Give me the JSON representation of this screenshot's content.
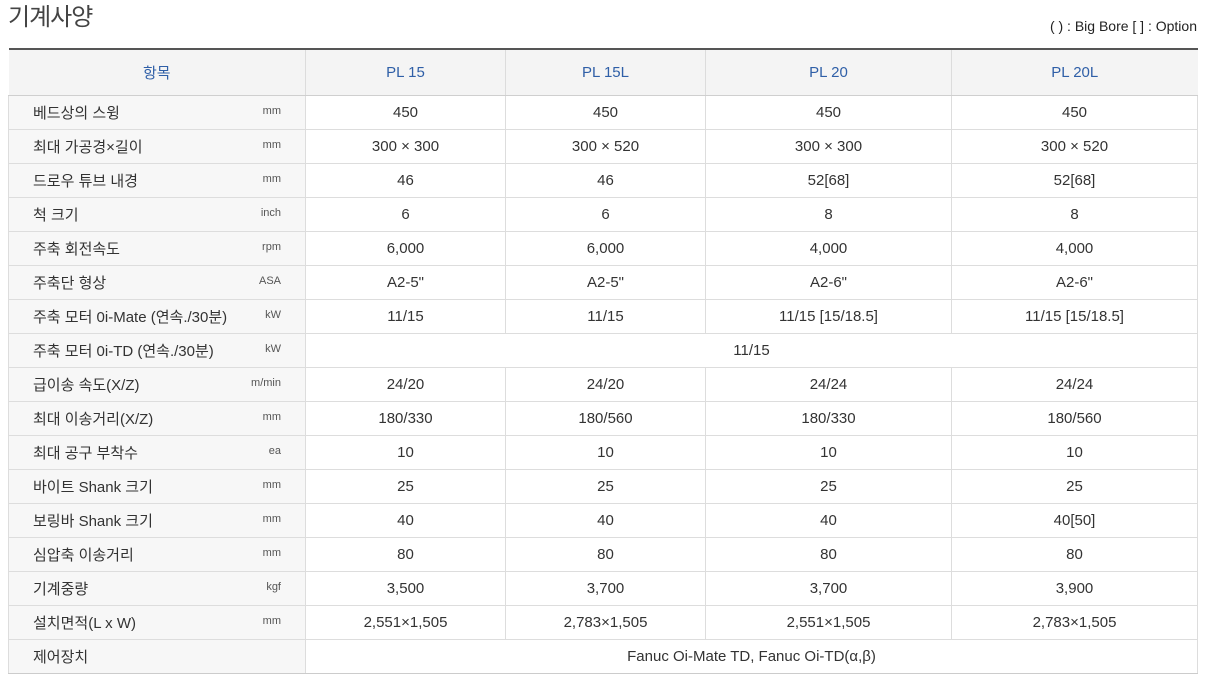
{
  "page_title": "기계사양",
  "legend": "( ) : Big Bore  [ ] : Option",
  "header": {
    "item": "항목",
    "models": [
      "PL 15",
      "PL 15L",
      "PL 20",
      "PL 20L"
    ]
  },
  "rows": [
    {
      "label": "베드상의 스윙",
      "unit": "mm",
      "values": [
        "450",
        "450",
        "450",
        "450"
      ]
    },
    {
      "label": "최대 가공경×길이",
      "unit": "mm",
      "values": [
        "300 × 300",
        "300 × 520",
        "300 × 300",
        "300 × 520"
      ]
    },
    {
      "label": "드로우 튜브 내경",
      "unit": "mm",
      "values": [
        "46",
        "46",
        "52[68]",
        "52[68]"
      ]
    },
    {
      "label": "척 크기",
      "unit": "inch",
      "values": [
        "6",
        "6",
        "8",
        "8"
      ]
    },
    {
      "label": "주축 회전속도",
      "unit": "rpm",
      "values": [
        "6,000",
        "6,000",
        "4,000",
        "4,000"
      ]
    },
    {
      "label": "주축단 형상",
      "unit": "ASA",
      "values": [
        "A2-5\"",
        "A2-5\"",
        "A2-6\"",
        "A2-6\""
      ]
    },
    {
      "label": "주축 모터 0i-Mate (연속./30분)",
      "unit": "kW",
      "values": [
        "11/15",
        "11/15",
        "11/15 [15/18.5]",
        "11/15 [15/18.5]"
      ]
    },
    {
      "label": "주축 모터 0i-TD (연속./30분)",
      "unit": "kW",
      "merged": "11/15"
    },
    {
      "label": "급이송 속도(X/Z)",
      "unit": "m/min",
      "values": [
        "24/20",
        "24/20",
        "24/24",
        "24/24"
      ]
    },
    {
      "label": "최대 이송거리(X/Z)",
      "unit": "mm",
      "values": [
        "180/330",
        "180/560",
        "180/330",
        "180/560"
      ]
    },
    {
      "label": "최대 공구 부착수",
      "unit": "ea",
      "values": [
        "10",
        "10",
        "10",
        "10"
      ]
    },
    {
      "label": "바이트 Shank 크기",
      "unit": "mm",
      "values": [
        "25",
        "25",
        "25",
        "25"
      ]
    },
    {
      "label": "보링바 Shank 크기",
      "unit": "mm",
      "values": [
        "40",
        "40",
        "40",
        "40[50]"
      ]
    },
    {
      "label": "심압축 이송거리",
      "unit": "mm",
      "values": [
        "80",
        "80",
        "80",
        "80"
      ]
    },
    {
      "label": "기계중량",
      "unit": "kgf",
      "values": [
        "3,500",
        "3,700",
        "3,700",
        "3,900"
      ]
    },
    {
      "label": "설치면적(L x W)",
      "unit": "mm",
      "values": [
        "2,551×1,505",
        "2,783×1,505",
        "2,551×1,505",
        "2,783×1,505"
      ]
    },
    {
      "label": "제어장치",
      "unit": "",
      "merged": "Fanuc Oi-Mate TD, Fanuc Oi-TD(α,β)"
    }
  ]
}
